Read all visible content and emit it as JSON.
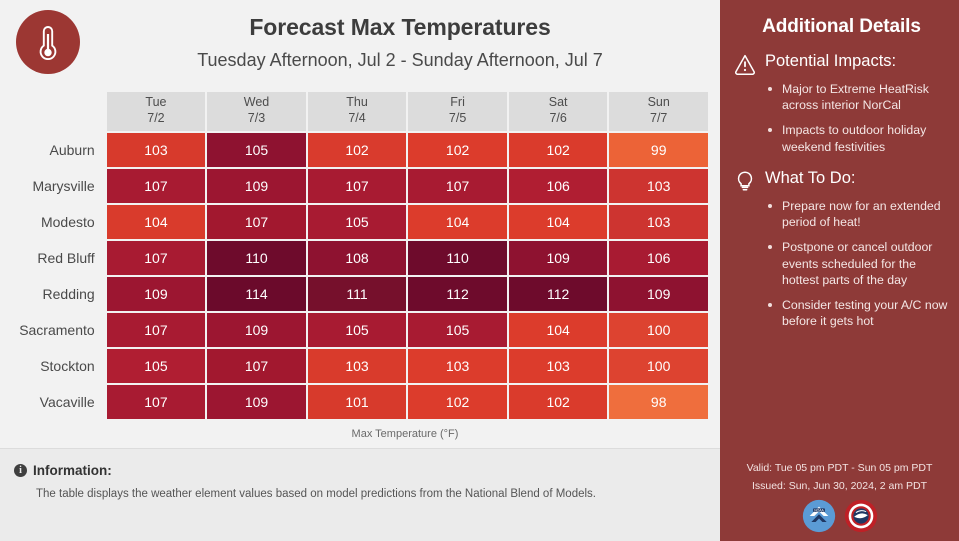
{
  "header": {
    "logo_icon": "thermometer-icon",
    "title": "Forecast Max Temperatures",
    "subtitle": "Tuesday Afternoon, Jul 2 - Sunday Afternoon, Jul 7"
  },
  "table": {
    "caption": "Max Temperature (°F)",
    "columns": [
      {
        "day": "Tue",
        "date": "7/2"
      },
      {
        "day": "Wed",
        "date": "7/3"
      },
      {
        "day": "Thu",
        "date": "7/4"
      },
      {
        "day": "Fri",
        "date": "7/5"
      },
      {
        "day": "Sat",
        "date": "7/6"
      },
      {
        "day": "Sun",
        "date": "7/7"
      }
    ],
    "rows": [
      {
        "city": "Auburn",
        "values": [
          103,
          105,
          102,
          102,
          102,
          99
        ]
      },
      {
        "city": "Marysville",
        "values": [
          107,
          109,
          107,
          107,
          106,
          103
        ]
      },
      {
        "city": "Modesto",
        "values": [
          104,
          107,
          105,
          104,
          104,
          103
        ]
      },
      {
        "city": "Red Bluff",
        "values": [
          107,
          110,
          108,
          110,
          109,
          106
        ]
      },
      {
        "city": "Redding",
        "values": [
          109,
          114,
          111,
          112,
          112,
          109
        ]
      },
      {
        "city": "Sacramento",
        "values": [
          107,
          109,
          105,
          105,
          104,
          100
        ]
      },
      {
        "city": "Stockton",
        "values": [
          105,
          107,
          103,
          103,
          103,
          100
        ]
      },
      {
        "city": "Vacaville",
        "values": [
          107,
          109,
          101,
          102,
          102,
          98
        ]
      }
    ],
    "cell_colors": [
      [
        "#d73a2c",
        "#8e1230",
        "#d93b2d",
        "#dc3c2c",
        "#da3b2c",
        "#ec6337"
      ],
      [
        "#a81b32",
        "#9c1631",
        "#a81b32",
        "#a81b32",
        "#b01e32",
        "#cd3430"
      ],
      [
        "#d93b2c",
        "#a2182f",
        "#a81b32",
        "#dc3c2c",
        "#dc3c2c",
        "#cd3430"
      ],
      [
        "#a81b32",
        "#6e0b2c",
        "#8e1230",
        "#6e0b2c",
        "#8e1230",
        "#a81b32"
      ],
      [
        "#9c1631",
        "#6b0a2b",
        "#76102c",
        "#6e0b2c",
        "#6e0b2c",
        "#8e1230"
      ],
      [
        "#a81b32",
        "#9c1631",
        "#a81b32",
        "#a81b32",
        "#dc3c2c",
        "#dd4330"
      ],
      [
        "#b01e32",
        "#a2182f",
        "#d93b2c",
        "#dc3c2c",
        "#dc3c2c",
        "#dd4330"
      ],
      [
        "#a81b32",
        "#9c1631",
        "#d73a2c",
        "#dc3c2c",
        "#da3b2c",
        "#ef6e3d"
      ]
    ]
  },
  "info": {
    "icon": "info-icon",
    "heading": "Information:",
    "body": "The table displays the weather element values based on model predictions from the National Blend of Models."
  },
  "sidebar": {
    "title": "Additional Details",
    "sections": [
      {
        "icon": "warning-triangle-icon",
        "title": "Potential Impacts:",
        "bullets": [
          "Major to Extreme HeatRisk across interior NorCal",
          "Impacts to outdoor holiday weekend festivities"
        ]
      },
      {
        "icon": "lightbulb-icon",
        "title": "What To Do:",
        "bullets": [
          "Prepare now for an extended period of heat!",
          "Postpone or cancel outdoor events scheduled for the hottest parts of the day",
          "Consider testing your A/C now before it gets hot"
        ]
      }
    ],
    "footer": {
      "valid": "Valid: Tue 05 pm PDT - Sun 05 pm PDT",
      "issued": "Issued: Sun, Jun 30, 2024, 2 am PDT",
      "logos": [
        "noaa-logo",
        "nws-logo"
      ]
    }
  },
  "chart_data": {
    "type": "heatmap",
    "title": "Forecast Max Temperatures",
    "subtitle": "Tuesday Afternoon, Jul 2 - Sunday Afternoon, Jul 7",
    "xlabel": "",
    "ylabel": "",
    "colorbar_label": "Max Temperature (°F)",
    "x_categories": [
      "Tue 7/2",
      "Wed 7/3",
      "Thu 7/4",
      "Fri 7/5",
      "Sat 7/6",
      "Sun 7/7"
    ],
    "y_categories": [
      "Auburn",
      "Marysville",
      "Modesto",
      "Red Bluff",
      "Redding",
      "Sacramento",
      "Stockton",
      "Vacaville"
    ],
    "values": [
      [
        103,
        105,
        102,
        102,
        102,
        99
      ],
      [
        107,
        109,
        107,
        107,
        106,
        103
      ],
      [
        104,
        107,
        105,
        104,
        104,
        103
      ],
      [
        107,
        110,
        108,
        110,
        109,
        106
      ],
      [
        109,
        114,
        111,
        112,
        112,
        109
      ],
      [
        107,
        109,
        105,
        105,
        104,
        100
      ],
      [
        105,
        107,
        103,
        103,
        103,
        100
      ],
      [
        107,
        109,
        101,
        102,
        102,
        98
      ]
    ],
    "value_range": [
      98,
      114
    ],
    "colorscale": "light-orange-red to dark-maroon (per-column relative)",
    "grid": false,
    "legend": "none"
  },
  "colors": {
    "brand_maroon": "#8e3a38",
    "logo_circle": "#9c3733",
    "page_background": "#f2f2f2",
    "info_bar": "#ebebeb",
    "header_cell": "#dcdcdc",
    "hot_extreme": "#6b0a2b",
    "hot_mild": "#ef6e3d"
  }
}
